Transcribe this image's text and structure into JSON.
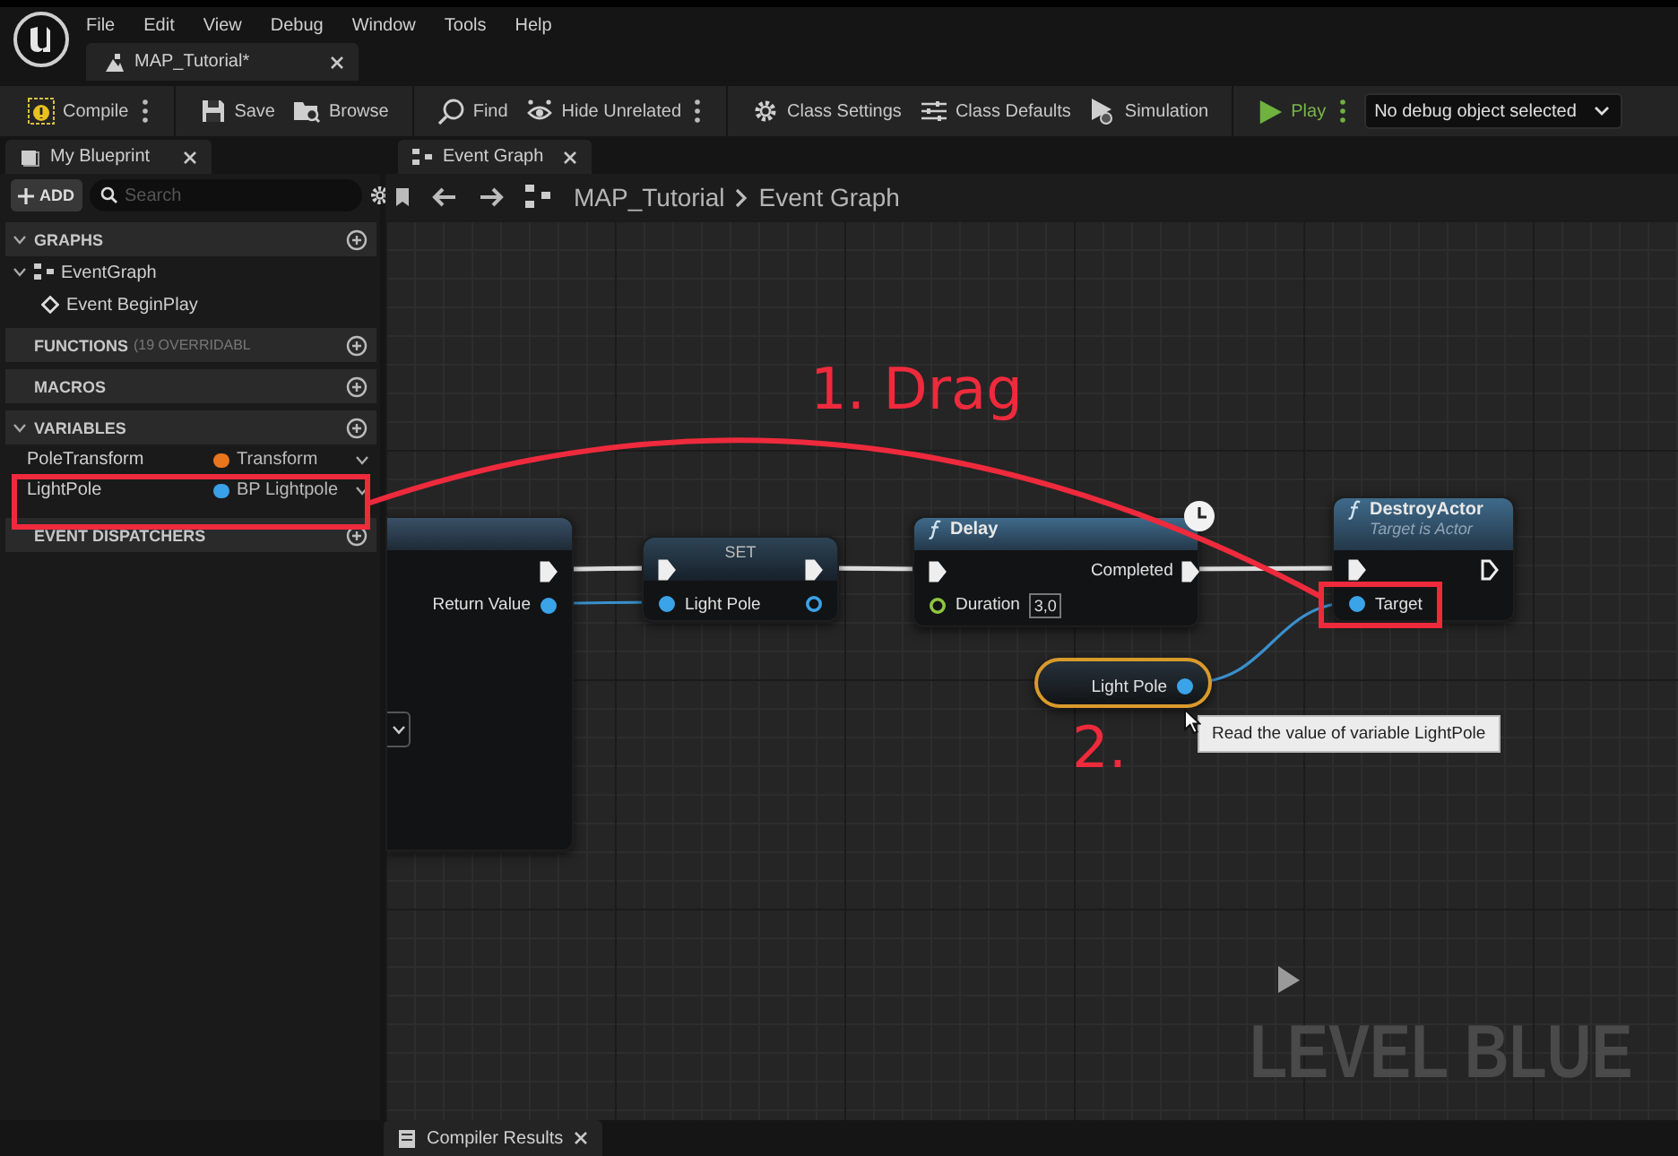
{
  "menu": [
    "File",
    "Edit",
    "View",
    "Debug",
    "Window",
    "Tools",
    "Help"
  ],
  "document_tab": "MAP_Tutorial*",
  "toolbar": [
    {
      "kind": "compile",
      "label": "Compile",
      "menu": true
    },
    {
      "kind": "save",
      "label": "Save",
      "menu": false
    },
    {
      "kind": "browse",
      "label": "Browse",
      "menu": false
    },
    {
      "kind": "find",
      "label": "Find",
      "menu": false
    },
    {
      "kind": "hide",
      "label": "Hide Unrelated",
      "menu": true
    },
    {
      "kind": "settings",
      "label": "Class Settings",
      "menu": false
    },
    {
      "kind": "defaults",
      "label": "Class Defaults",
      "menu": false
    },
    {
      "kind": "simulation",
      "label": "Simulation",
      "menu": false
    },
    {
      "kind": "play",
      "label": "Play",
      "menu": true
    }
  ],
  "debug_filter": "No debug object selected",
  "my_blueprint": {
    "tab": "My Blueprint",
    "add_button": "ADD",
    "search": {
      "placeholder": "Search"
    },
    "sections": [
      {
        "title": "GRAPHS",
        "expanded": true,
        "items": [
          {
            "label": "EventGraph",
            "kind": "graph",
            "expanded": true,
            "children": [
              {
                "label": "Event BeginPlay",
                "kind": "event"
              }
            ]
          }
        ]
      },
      {
        "title": "FUNCTIONS",
        "note": "(19 OVERRIDABL",
        "expanded": false
      },
      {
        "title": "MACROS",
        "expanded": false
      },
      {
        "title": "VARIABLES",
        "expanded": true,
        "variables": [
          {
            "name": "PoleTransform",
            "type": "Transform",
            "color": "#e8761e"
          },
          {
            "name": "LightPole",
            "type": "BP Lightpole",
            "color": "#3aa0e8"
          }
        ]
      },
      {
        "title": "EVENT DISPATCHERS",
        "expanded": false
      }
    ]
  },
  "graph": {
    "tab": "Event Graph",
    "breadcrumb": [
      "MAP_Tutorial",
      "Event Graph"
    ],
    "nodes": [
      {
        "kind": "partial",
        "selected": false,
        "outputs": [
          {
            "kind": "exec",
            "connected": true
          },
          {
            "kind": "object",
            "label": "Return Value",
            "connected": true
          }
        ]
      },
      {
        "kind": "set",
        "title": "SET",
        "selected": false,
        "inputs": [
          {
            "kind": "exec",
            "connected": true
          },
          {
            "kind": "object",
            "label": "Light Pole",
            "connected": true
          }
        ],
        "outputs": [
          {
            "kind": "exec",
            "connected": true
          },
          {
            "kind": "object",
            "connected": false
          }
        ]
      },
      {
        "kind": "function",
        "title": "Delay",
        "latent": true,
        "selected": false,
        "inputs": [
          {
            "kind": "exec",
            "connected": true
          },
          {
            "kind": "float",
            "label": "Duration",
            "value": "3,0",
            "connected": false
          }
        ],
        "outputs": [
          {
            "kind": "exec",
            "label": "Completed",
            "connected": true
          }
        ]
      },
      {
        "kind": "function",
        "title": "DestroyActor",
        "subtitle": "Target is Actor",
        "latent": false,
        "selected": false,
        "inputs": [
          {
            "kind": "exec",
            "connected": true
          },
          {
            "kind": "object",
            "label": "Target",
            "connected": true
          }
        ],
        "outputs": [
          {
            "kind": "exec",
            "connected": false
          }
        ]
      },
      {
        "kind": "getter",
        "selected": true,
        "outputs": [
          {
            "kind": "object",
            "label": "Light Pole",
            "connected": true
          }
        ]
      }
    ],
    "tooltip": "Read the value of variable LightPole",
    "watermark": "LEVEL BLUE"
  },
  "annotations": [
    "1. Drag",
    "2."
  ],
  "bottom_tab": "Compiler Results"
}
